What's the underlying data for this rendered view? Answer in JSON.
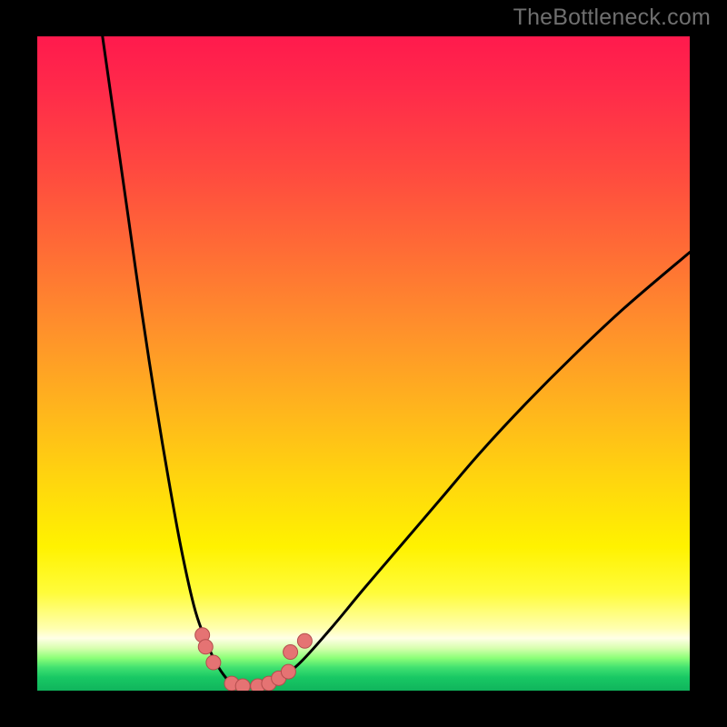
{
  "watermark": "TheBottleneck.com",
  "colors": {
    "page_bg": "#000000",
    "curve_stroke": "#000000",
    "marker_fill": "#e57373",
    "marker_stroke": "#b34d4d",
    "gradient_top": "#ff1a4d",
    "gradient_mid": "#fff200",
    "gradient_bottom": "#10b45c"
  },
  "chart_data": {
    "type": "line",
    "title": "",
    "xlabel": "",
    "ylabel": "",
    "xlim": [
      0,
      100
    ],
    "ylim": [
      0,
      100
    ],
    "axes_visible": false,
    "grid": false,
    "background": "vertical-gradient red→yellow→green",
    "series": [
      {
        "name": "curve-left",
        "x": [
          10.0,
          12.0,
          14.0,
          16.0,
          18.0,
          20.0,
          22.0,
          24.0,
          25.5,
          27.0,
          28.5,
          30.0
        ],
        "y": [
          100.0,
          86.0,
          72.0,
          58.0,
          45.0,
          33.0,
          22.0,
          13.0,
          8.5,
          5.0,
          2.5,
          1.0
        ]
      },
      {
        "name": "curve-floor",
        "x": [
          30.0,
          32.0,
          34.0,
          36.0
        ],
        "y": [
          1.0,
          0.6,
          0.6,
          1.0
        ]
      },
      {
        "name": "curve-right",
        "x": [
          36.0,
          40.0,
          45.0,
          50.0,
          56.0,
          62.0,
          68.0,
          75.0,
          82.0,
          90.0,
          100.0
        ],
        "y": [
          1.0,
          4.0,
          9.5,
          15.5,
          22.5,
          29.5,
          36.5,
          44.0,
          51.0,
          58.5,
          67.0
        ]
      }
    ],
    "markers": [
      {
        "x": 25.3,
        "y": 8.5
      },
      {
        "x": 25.8,
        "y": 6.7
      },
      {
        "x": 27.0,
        "y": 4.3
      },
      {
        "x": 29.8,
        "y": 1.1
      },
      {
        "x": 31.5,
        "y": 0.7
      },
      {
        "x": 33.8,
        "y": 0.7
      },
      {
        "x": 35.5,
        "y": 1.1
      },
      {
        "x": 37.0,
        "y": 1.9
      },
      {
        "x": 38.5,
        "y": 2.9
      },
      {
        "x": 38.8,
        "y": 5.9
      },
      {
        "x": 41.0,
        "y": 7.6
      }
    ],
    "marker_radius": 8
  }
}
